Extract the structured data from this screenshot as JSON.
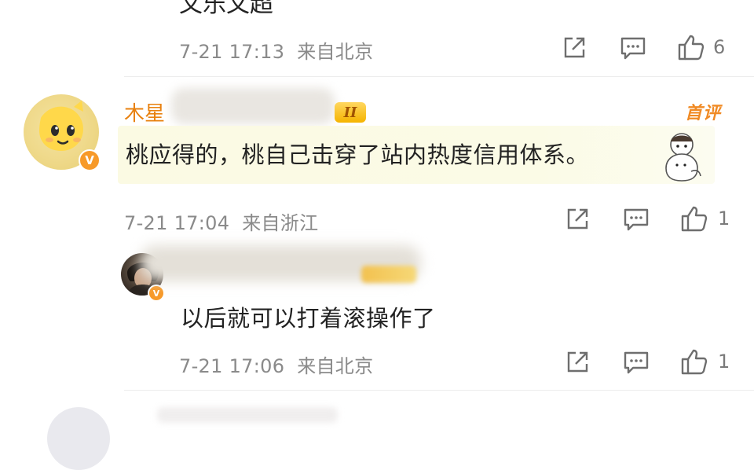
{
  "previous_reply": {
    "text": "文乐文超",
    "time": "7-21 17:13",
    "location": "来自北京",
    "like_count": "6"
  },
  "comment": {
    "username_visible": "木星",
    "level_badge": "II",
    "first_comment_badge": "首评",
    "text": "桃应得的，桃自己击穿了站内热度信用体系。",
    "time": "7-21 17:04",
    "location": "来自浙江",
    "like_count": "1",
    "verified_mark": "V"
  },
  "reply": {
    "text": "以后就可以打着滚操作了",
    "time": "7-21 17:06",
    "location": "来自北京",
    "like_count": "1",
    "verified_mark": "V"
  },
  "colors": {
    "username": "#e8810f",
    "meta_text": "#8a8a8a",
    "highlight_bg": "#fbfae3",
    "badge_orange": "#f79a2a"
  },
  "icons": [
    "share-icon",
    "comment-icon",
    "like-icon"
  ]
}
